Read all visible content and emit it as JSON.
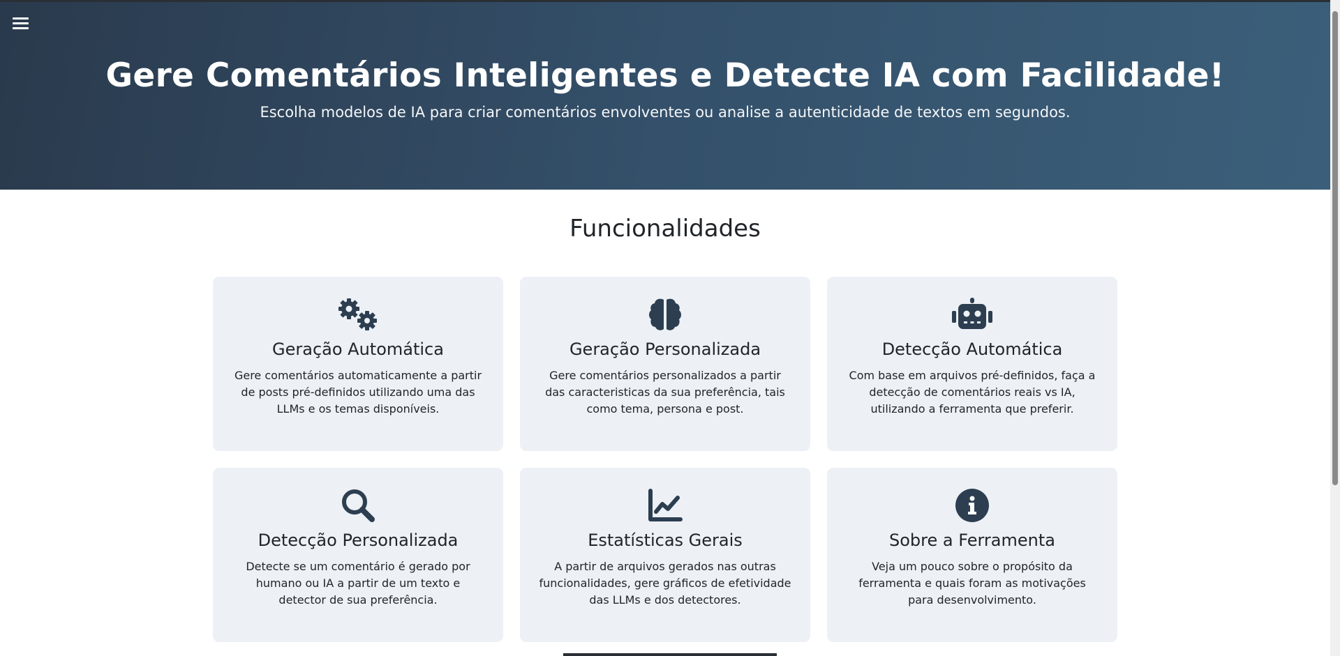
{
  "hero": {
    "title": "Gere Comentários Inteligentes e Detecte IA com Facilidade!",
    "subtitle": "Escolha modelos de IA para criar comentários envolventes ou analise a autenticidade de textos em segundos."
  },
  "section": {
    "title": "Funcionalidades"
  },
  "cards": [
    {
      "icon": "gears-icon",
      "title": "Geração Automática",
      "text": "Gere comentários automaticamente a partir de posts pré-definidos utilizando uma das LLMs e os temas disponíveis."
    },
    {
      "icon": "brain-icon",
      "title": "Geração Personalizada",
      "text": "Gere comentários personalizados a partir das caracteristicas da sua preferência, tais como tema, persona e post."
    },
    {
      "icon": "robot-icon",
      "title": "Detecção Automática",
      "text": "Com base em arquivos pré-definidos, faça a detecção de comentários reais vs IA, utilizando a ferramenta que preferir."
    },
    {
      "icon": "search-icon",
      "title": "Detecção Personalizada",
      "text": "Detecte se um comentário é gerado por humano ou IA a partir de um texto e detector de sua preferência."
    },
    {
      "icon": "chart-line-icon",
      "title": "Estatísticas Gerais",
      "text": "A partir de arquivos gerados nas outras funcionalidades, gere gráficos de efetividade das LLMs e dos detectores."
    },
    {
      "icon": "info-circle-icon",
      "title": "Sobre a Ferramenta",
      "text": "Veja um pouco sobre o propósito da ferramenta e quais foram as motivações para desenvolvimento."
    }
  ],
  "colors": {
    "hero_start": "#2a3a4d",
    "hero_end": "#3b5f7a",
    "card_bg": "#edf0f5",
    "icon": "#2c3e50"
  }
}
